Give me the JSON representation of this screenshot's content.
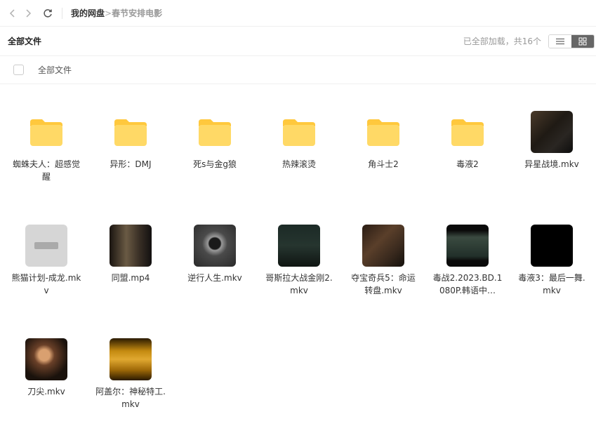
{
  "breadcrumb": {
    "root": "我的网盘",
    "separator": ">",
    "current": "春节安排电影"
  },
  "header": {
    "title": "全部文件",
    "status": "已全部加载，共16个"
  },
  "select_bar": {
    "label": "全部文件"
  },
  "colors": {
    "folder_back": "#FFC83D",
    "folder_front": "#FFD966",
    "accent_active_view": "#666666"
  },
  "view_modes": [
    "list-icon",
    "grid-icon"
  ],
  "items": [
    {
      "name": "蜘蛛夫人：超感觉醒",
      "type": "folder"
    },
    {
      "name": "异形：DMJ",
      "type": "folder"
    },
    {
      "name": "死s与金g狼",
      "type": "folder"
    },
    {
      "name": "热辣滚烫",
      "type": "folder"
    },
    {
      "name": "角斗士2",
      "type": "folder"
    },
    {
      "name": "毒液2",
      "type": "folder"
    },
    {
      "name": "异星战境.mkv",
      "type": "video"
    },
    {
      "name": "熊猫计划-成龙.mkv",
      "type": "video"
    },
    {
      "name": "同盟.mp4",
      "type": "video"
    },
    {
      "name": "逆行人生.mkv",
      "type": "video"
    },
    {
      "name": "哥斯拉大战金刚2.mkv",
      "type": "video"
    },
    {
      "name": "夺宝奇兵5：命运转盘.mkv",
      "type": "video"
    },
    {
      "name": "毒战2.2023.BD.1080P.韩语中…",
      "type": "video"
    },
    {
      "name": "毒液3：最后一舞.mkv",
      "type": "video"
    },
    {
      "name": "刀尖.mkv",
      "type": "video"
    },
    {
      "name": "阿盖尔：神秘特工.mkv",
      "type": "video"
    }
  ]
}
